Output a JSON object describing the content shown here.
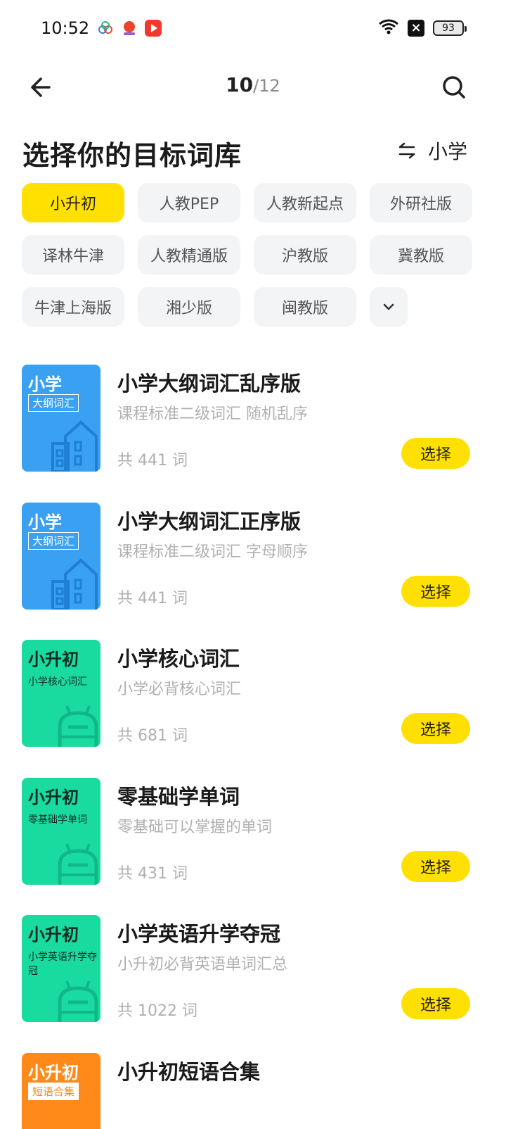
{
  "status_bar": {
    "time": "10:52",
    "battery": "93",
    "icons": [
      "wifi-icon",
      "no-sim-icon",
      "battery-icon"
    ]
  },
  "header": {
    "progress_current": "10",
    "progress_separator": "/",
    "progress_total": "12",
    "back_icon": "arrow-left-icon",
    "search_icon": "search-icon"
  },
  "title": "选择你的目标词库",
  "level_switch": {
    "icon": "swap-icon",
    "label": "小学"
  },
  "chips": [
    {
      "label": "小升初",
      "active": true
    },
    {
      "label": "人教PEP",
      "active": false
    },
    {
      "label": "人教新起点",
      "active": false
    },
    {
      "label": "外研社版",
      "active": false
    },
    {
      "label": "译林牛津",
      "active": false
    },
    {
      "label": "人教精通版",
      "active": false
    },
    {
      "label": "沪教版",
      "active": false
    },
    {
      "label": "冀教版",
      "active": false
    },
    {
      "label": "牛津上海版",
      "active": false
    },
    {
      "label": "湘少版",
      "active": false
    },
    {
      "label": "闽教版",
      "active": false
    }
  ],
  "chips_more_icon": "chevron-down-icon",
  "books": [
    {
      "cover_title": "小学",
      "cover_sub": "大纲词汇",
      "cover_color": "#3aa0f2",
      "title": "小学大纲词汇乱序版",
      "desc": "课程标准二级词汇 随机乱序",
      "count": "共 441 词",
      "button": "选择"
    },
    {
      "cover_title": "小学",
      "cover_sub": "大纲词汇",
      "cover_color": "#3aa0f2",
      "title": "小学大纲词汇正序版",
      "desc": "课程标准二级词汇 字母顺序",
      "count": "共 441 词",
      "button": "选择"
    },
    {
      "cover_title": "小升初",
      "cover_sub": "小学核心词汇",
      "cover_color": "#19dba0",
      "title": "小学核心词汇",
      "desc": "小学必背核心词汇",
      "count": "共 681 词",
      "button": "选择"
    },
    {
      "cover_title": "小升初",
      "cover_sub": "零基础学单词",
      "cover_color": "#19dba0",
      "title": "零基础学单词",
      "desc": "零基础可以掌握的单词",
      "count": "共 431 词",
      "button": "选择"
    },
    {
      "cover_title": "小升初",
      "cover_sub": "小学英语升学夺冠",
      "cover_color": "#19dba0",
      "title": "小学英语升学夺冠",
      "desc": "小升初必背英语单词汇总",
      "count": "共 1022 词",
      "button": "选择"
    },
    {
      "cover_title": "小升初",
      "cover_sub": "短语合集",
      "cover_color": "#ff8a1a",
      "title": "小升初短语合集"
    }
  ],
  "colors": {
    "accent": "#ffe000",
    "chip_bg": "#f3f4f6",
    "muted_text": "#b0b0b0"
  }
}
